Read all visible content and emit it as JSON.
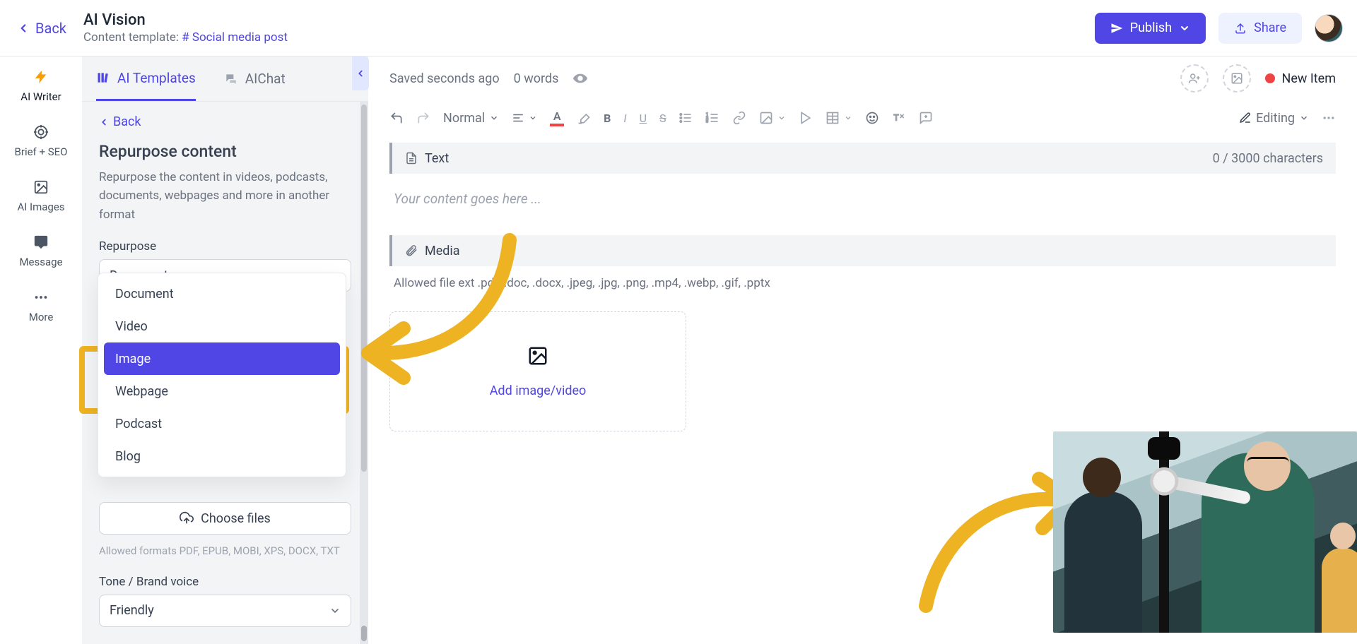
{
  "header": {
    "back": "Back",
    "title": "AI Vision",
    "template_label": "Content template:",
    "template_link": "# Social media post",
    "publish": "Publish",
    "share": "Share"
  },
  "leftnav": {
    "writer": "AI Writer",
    "brief": "Brief + SEO",
    "images": "AI Images",
    "message": "Message",
    "more": "More"
  },
  "tabs": {
    "templates": "AI Templates",
    "chat": "AIChat"
  },
  "panel": {
    "back": "Back",
    "title": "Repurpose content",
    "desc": "Repurpose the content in videos, podcasts, documents, webpages and more in another format",
    "repurpose_label": "Repurpose",
    "repurpose_value": "Document",
    "options": {
      "o0": "Document",
      "o1": "Video",
      "o2": "Image",
      "o3": "Webpage",
      "o4": "Podcast",
      "o5": "Blog"
    },
    "choose_files": "Choose files",
    "formats_hint": "Allowed formats PDF, EPUB, MOBI, XPS, DOCX, TXT",
    "tone_label": "Tone / Brand voice",
    "tone_value": "Friendly"
  },
  "editor": {
    "saved": "Saved seconds ago",
    "words": "0 words",
    "new_item": "New Item",
    "style_normal": "Normal",
    "editing": "Editing",
    "text_block": "Text",
    "char_counter": "0 / 3000 characters",
    "text_placeholder": "Your content goes here ...",
    "media_block": "Media",
    "allowed_ext": "Allowed file ext     .pdf, .doc, .docx, .jpeg, .jpg, .png, .mp4, .webp, .gif, .pptx",
    "add_media": "Add image/video"
  }
}
